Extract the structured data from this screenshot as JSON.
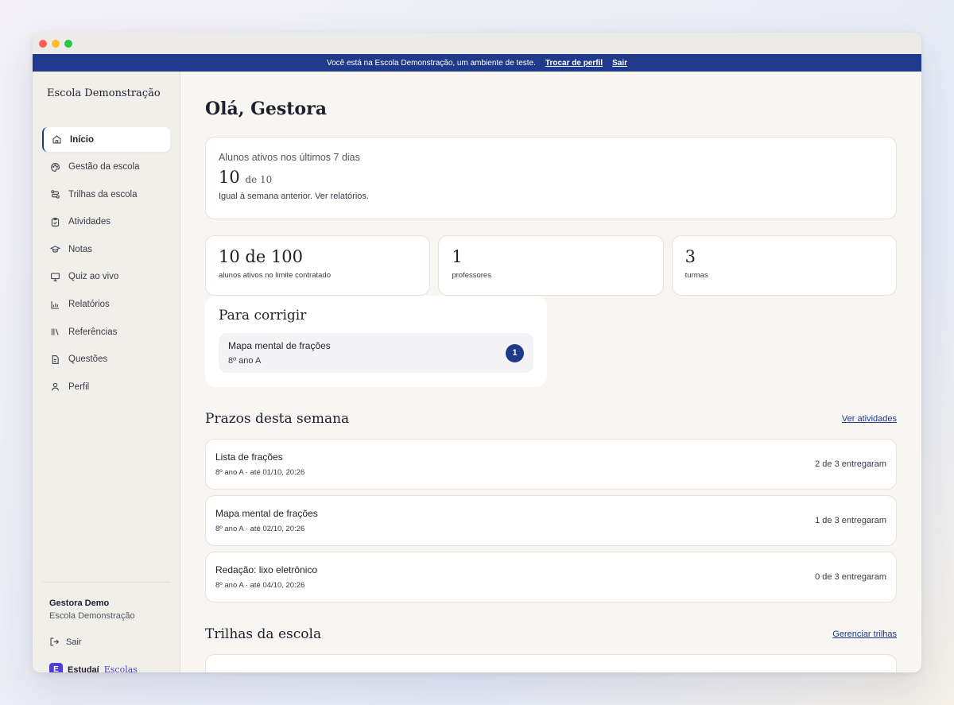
{
  "banner": {
    "text": "Você está na Escola Demonstração, um ambiente de teste.",
    "switch_profile": "Trocar de perfil",
    "logout": "Sair"
  },
  "sidebar": {
    "brand": "Escola Demonstração",
    "items": [
      {
        "label": "Início",
        "icon": "home-icon"
      },
      {
        "label": "Gestão da escola",
        "icon": "palette-icon"
      },
      {
        "label": "Trilhas da escola",
        "icon": "route-icon"
      },
      {
        "label": "Atividades",
        "icon": "clipboard-icon"
      },
      {
        "label": "Notas",
        "icon": "graduation-cap-icon"
      },
      {
        "label": "Quiz ao vivo",
        "icon": "presentation-icon"
      },
      {
        "label": "Relatórios",
        "icon": "bar-chart-icon"
      },
      {
        "label": "Referências",
        "icon": "library-icon"
      },
      {
        "label": "Questões",
        "icon": "file-text-icon"
      },
      {
        "label": "Perfil",
        "icon": "user-icon"
      }
    ],
    "user_name": "Gestora Demo",
    "user_school": "Escola Demonstração",
    "logout": "Sair",
    "logo_name": "Estudaí",
    "logo_sub": "Escolas"
  },
  "main": {
    "greeting": "Olá, Gestora",
    "active_students": {
      "label": "Alunos ativos nos últimos 7 dias",
      "value": "10",
      "total": "de 10",
      "note": "Igual à semana anterior. Ver relatórios."
    },
    "stats": [
      {
        "value": "10 de 100",
        "caption": "alunos ativos no limite contratado"
      },
      {
        "value": "1",
        "caption": "professores"
      },
      {
        "value": "3",
        "caption": "turmas"
      }
    ],
    "to_correct": {
      "title": "Para corrigir",
      "items": [
        {
          "title": "Mapa mental de frações",
          "class": "8º ano A",
          "count": "1"
        }
      ]
    },
    "deadlines": {
      "title": "Prazos desta semana",
      "link": "Ver atividades",
      "items": [
        {
          "title": "Lista de frações",
          "sub": "8º ano A · até 01/10, 20:26",
          "status": "2 de 3 entregaram"
        },
        {
          "title": "Mapa mental de frações",
          "sub": "8º ano A · até 02/10, 20:26",
          "status": "1 de 3 entregaram"
        },
        {
          "title": "Redação: lixo eletrônico",
          "sub": "8º ano A · até 04/10, 20:26",
          "status": "0 de 3 entregaram"
        }
      ]
    },
    "trails": {
      "title": "Trilhas da escola",
      "link": "Gerenciar trilhas"
    }
  },
  "colors": {
    "accent": "#1f3a8a",
    "brand_logo": "#4b3fd6"
  }
}
